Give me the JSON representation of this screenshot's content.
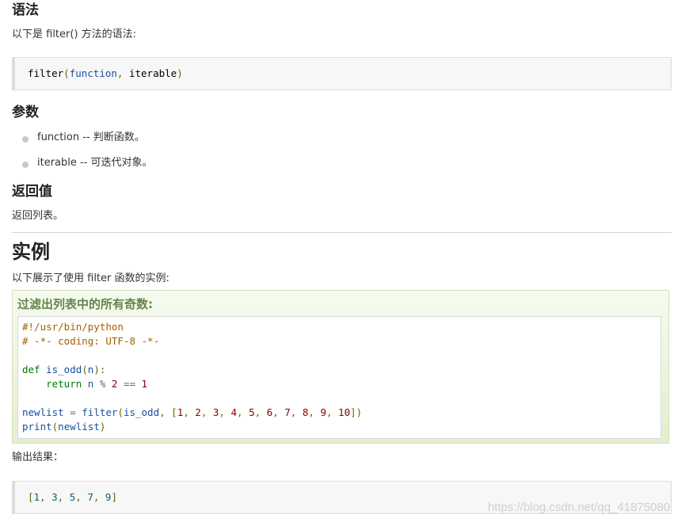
{
  "syntax": {
    "heading": "语法",
    "intro": "以下是 filter() 方法的语法:",
    "code": {
      "fn": "filter",
      "open": "(",
      "arg1": "function",
      "comma": ", ",
      "arg2": "iterable",
      "close": ")"
    }
  },
  "params": {
    "heading": "参数",
    "items": [
      {
        "label": "function -- 判断函数。"
      },
      {
        "label": "iterable -- 可迭代对象。"
      }
    ]
  },
  "returns": {
    "heading": "返回值",
    "text": "返回列表。"
  },
  "example": {
    "heading": "实例",
    "intro": "以下展示了使用 filter 函数的实例:",
    "box_title": "过滤出列表中的所有奇数:",
    "code": {
      "l1": "#!/usr/bin/python",
      "l2": "# -*- coding: UTF-8 -*-",
      "l4_kw": "def",
      "l4_name": "is_odd",
      "l4_open": "(",
      "l4_param": "n",
      "l4_close": "):",
      "l5_indent": "    ",
      "l5_kw": "return",
      "l5_rest1": " n ",
      "l5_op": "%",
      "l5_sp": " ",
      "l5_num1": "2",
      "l5_eq": " == ",
      "l5_num2": "1",
      "l7_var": "newlist",
      "l7_eq": " = ",
      "l7_fn": "filter",
      "l7_open": "(",
      "l7_arg": "is_odd",
      "l7_comma": ", ",
      "l7_lb": "[",
      "l7_nums": [
        "1",
        "2",
        "3",
        "4",
        "5",
        "6",
        "7",
        "8",
        "9",
        "10"
      ],
      "l7_rb": "])",
      "l8_fn": "print",
      "l8_open": "(",
      "l8_arg": "newlist",
      "l8_close": ")"
    }
  },
  "output": {
    "label": "输出结果：",
    "lb": "[",
    "nums": [
      "1",
      "3",
      "5",
      "7",
      "9"
    ],
    "rb": "]"
  },
  "watermark": "https://blog.csdn.net/qq_41875080"
}
